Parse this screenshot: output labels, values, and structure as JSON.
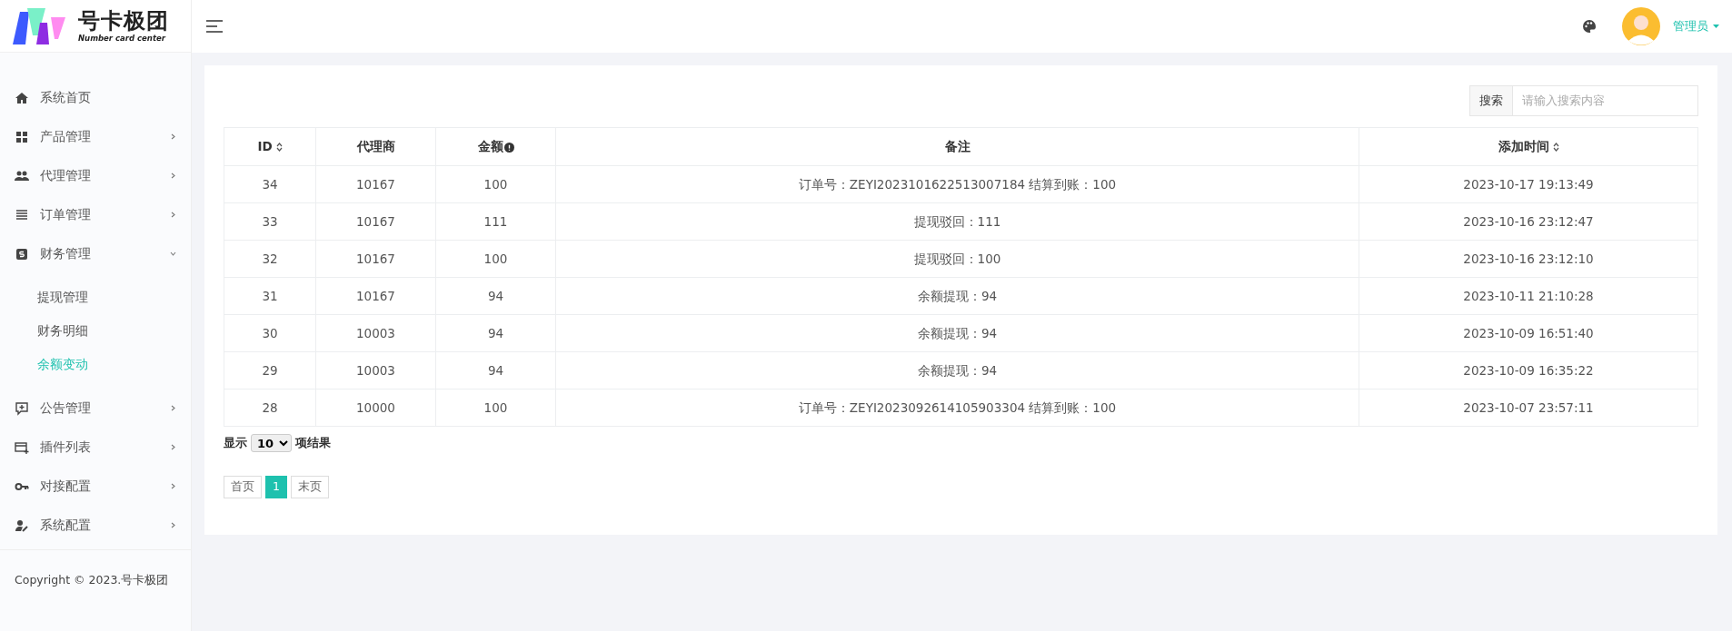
{
  "logo": {
    "title": "号卡极团",
    "subtitle": "Number card center"
  },
  "sidebar": {
    "items": [
      {
        "label": "系统首页"
      },
      {
        "label": "产品管理",
        "expanded": false
      },
      {
        "label": "代理管理",
        "expanded": false
      },
      {
        "label": "订单管理",
        "expanded": false
      },
      {
        "label": "财务管理",
        "expanded": true,
        "children": [
          {
            "label": "提现管理",
            "selected": false
          },
          {
            "label": "财务明细",
            "selected": false
          },
          {
            "label": "余额变动",
            "selected": true
          }
        ]
      },
      {
        "label": "公告管理",
        "expanded": false
      },
      {
        "label": "插件列表",
        "expanded": false
      },
      {
        "label": "对接配置",
        "expanded": false
      },
      {
        "label": "系统配置",
        "expanded": false
      }
    ],
    "copyright": "Copyright © 2023.号卡极团"
  },
  "header": {
    "user": "管理员"
  },
  "search": {
    "label": "搜索",
    "placeholder": "请输入搜索内容"
  },
  "table": {
    "columns": [
      {
        "label": "ID",
        "sortable": true,
        "hint_icon": false
      },
      {
        "label": "代理商",
        "sortable": false,
        "hint_icon": false
      },
      {
        "label": "金额",
        "sortable": false,
        "hint_icon": true
      },
      {
        "label": "备注",
        "sortable": false,
        "hint_icon": false
      },
      {
        "label": "添加时间",
        "sortable": true,
        "hint_icon": false
      }
    ],
    "rows": [
      [
        "34",
        "10167",
        "100",
        "订单号：ZEYI2023101622513007184 结算到账：100",
        "2023-10-17 19:13:49"
      ],
      [
        "33",
        "10167",
        "111",
        "提现驳回：111",
        "2023-10-16 23:12:47"
      ],
      [
        "32",
        "10167",
        "100",
        "提现驳回：100",
        "2023-10-16 23:12:10"
      ],
      [
        "31",
        "10167",
        "94",
        "余额提现：94",
        "2023-10-11 21:10:28"
      ],
      [
        "30",
        "10003",
        "94",
        "余额提现：94",
        "2023-10-09 16:51:40"
      ],
      [
        "29",
        "10003",
        "94",
        "余额提现：94",
        "2023-10-09 16:35:22"
      ],
      [
        "28",
        "10000",
        "100",
        "订单号：ZEYI2023092614105903304 结算到账：100",
        "2023-10-07 23:57:11"
      ]
    ]
  },
  "page_size": {
    "before": "显示",
    "value": "10",
    "after": "项结果"
  },
  "pagination": [
    {
      "label": "首页",
      "selected": false
    },
    {
      "label": "1",
      "selected": true
    },
    {
      "label": "末页",
      "selected": false
    }
  ]
}
